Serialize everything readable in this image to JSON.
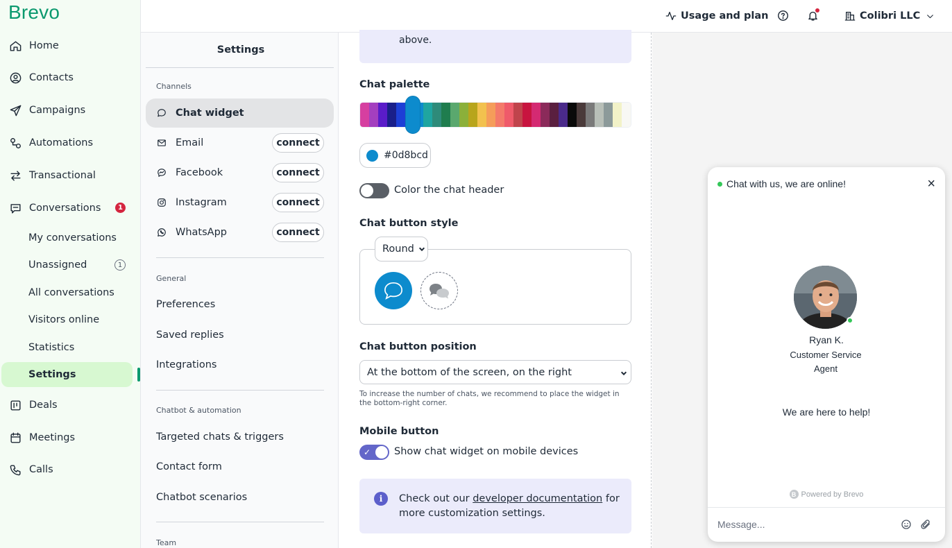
{
  "brand": {
    "logo": "Brevo",
    "accent": "#0b996e"
  },
  "sidebar": {
    "items": [
      {
        "label": "Home",
        "icon": "home-icon"
      },
      {
        "label": "Contacts",
        "icon": "contacts-icon"
      },
      {
        "label": "Campaigns",
        "icon": "send-icon"
      },
      {
        "label": "Automations",
        "icon": "automation-icon"
      },
      {
        "label": "Transactional",
        "icon": "arrows-icon"
      },
      {
        "label": "Conversations",
        "icon": "chat-icon",
        "badge": "1"
      },
      {
        "label": "Deals",
        "icon": "deals-icon"
      },
      {
        "label": "Meetings",
        "icon": "calendar-icon"
      },
      {
        "label": "Calls",
        "icon": "phone-icon"
      }
    ],
    "sub_items": [
      {
        "label": "My conversations"
      },
      {
        "label": "Unassigned",
        "badge": "1"
      },
      {
        "label": "All conversations"
      },
      {
        "label": "Visitors online"
      },
      {
        "label": "Statistics"
      },
      {
        "label": "Settings",
        "active": true
      }
    ]
  },
  "topbar": {
    "usage_label": "Usage and plan",
    "account_label": "Colibri LLC"
  },
  "settings": {
    "title": "Settings",
    "channels_label": "Channels",
    "channels": [
      {
        "label": "Chat widget",
        "active": true
      },
      {
        "label": "Email",
        "action": "connect"
      },
      {
        "label": "Facebook",
        "action": "connect"
      },
      {
        "label": "Instagram",
        "action": "connect"
      },
      {
        "label": "WhatsApp",
        "action": "connect"
      }
    ],
    "general_label": "General",
    "general": [
      "Preferences",
      "Saved replies",
      "Integrations"
    ],
    "chatbot_label": "Chatbot & automation",
    "chatbot": [
      "Targeted chats & triggers",
      "Contact form",
      "Chatbot scenarios"
    ],
    "team_label": "Team"
  },
  "form": {
    "info_top_text": "above.",
    "palette_label": "Chat palette",
    "palette_colors": [
      "#d63fa0",
      "#a43fbf",
      "#5a1cc9",
      "#1a1f8a",
      "#1d3fd6",
      "#1a73e8",
      "#0d8bcd",
      "#1fa5a0",
      "#2e8b7a",
      "#1f7d4e",
      "#5aa86e",
      "#8bb03a",
      "#b8a51c",
      "#f2c14e",
      "#f59d5a",
      "#f47a6a",
      "#ef5a6a",
      "#c0444c",
      "#c8143f",
      "#d42a72",
      "#8b2a5a",
      "#5a1f3f",
      "#4a2a8a",
      "#0a0a0a",
      "#4a3a3a",
      "#7a7a7a",
      "#b8bfb8",
      "#8c9a9a",
      "#f2f2c8",
      "#f8f8f4"
    ],
    "color_value": "#0d8bcd",
    "color_header_label": "Color the chat header",
    "button_style_label": "Chat button style",
    "button_style_value": "Round",
    "button_position_label": "Chat button position",
    "button_position_value": "At the bottom of the screen, on the right",
    "position_hint": "To increase the number of chats, we recommend to place the widget in the bottom-right corner.",
    "mobile_label": "Mobile button",
    "mobile_toggle_label": "Show chat widget on mobile devices",
    "info_bottom_prefix": "Check out our ",
    "info_bottom_link": "developer documentation",
    "info_bottom_suffix": " for more customization settings."
  },
  "preview": {
    "online_text": "Chat with us, we are online!",
    "agent_name": "Ryan K.",
    "agent_role": "Customer Service Agent",
    "help_text": "We are here to help!",
    "powered_by": "Powered by Brevo",
    "message_placeholder": "Message..."
  }
}
